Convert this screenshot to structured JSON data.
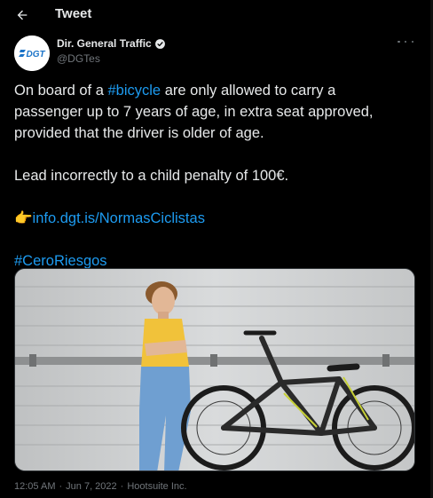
{
  "header": {
    "title": "Tweet"
  },
  "author": {
    "display_name": "Dir. General Traffic",
    "handle": "@DGTes",
    "verified": true,
    "avatar_text": "DGT"
  },
  "tweet": {
    "line1_pre": "On board of a ",
    "hashtag_bicycle": "#bicycle",
    "line1_post": " are only allowed to carry a",
    "line2": "passenger up to 7 years of age, in extra seat approved,",
    "line3": "provided that the driver is older of age.",
    "line4": "Lead incorrectly to a child penalty of 100€.",
    "pointing_emoji": "👉",
    "link_text": "info.dgt.is/NormasCiclistas",
    "hashtag_cero": "#CeroRiesgos"
  },
  "meta": {
    "time": "12:05 AM",
    "dot1": "·",
    "date": "Jun 7, 2022",
    "dot2": "·",
    "source": "Hootsuite Inc."
  },
  "colors": {
    "background": "#000000",
    "text": "#e7e9ea",
    "secondary": "#71767b",
    "link": "#1d9bf0",
    "dgt_blue": "#1a73c8"
  }
}
